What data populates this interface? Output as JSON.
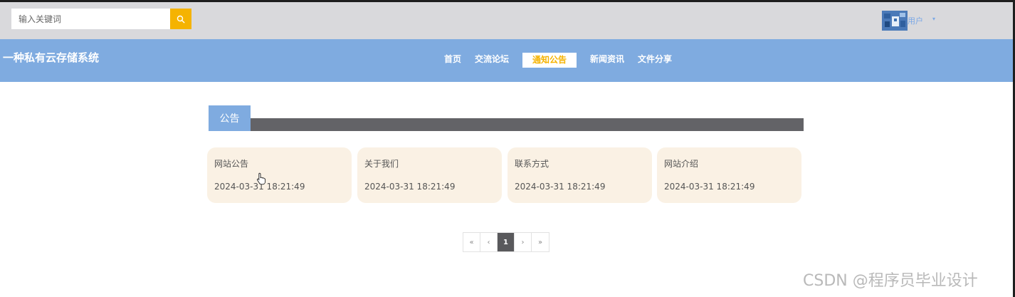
{
  "search": {
    "placeholder": "输入关键词",
    "icon": "search-icon"
  },
  "user": {
    "label": "用户",
    "caret": "▾"
  },
  "site": {
    "title": "一种私有云存储系统"
  },
  "nav": {
    "items": [
      {
        "label": "首页",
        "active": false
      },
      {
        "label": "交流论坛",
        "active": false
      },
      {
        "label": "通知公告",
        "active": true
      },
      {
        "label": "新闻资讯",
        "active": false
      },
      {
        "label": "文件分享",
        "active": false
      }
    ]
  },
  "section": {
    "title": "公告"
  },
  "notices": [
    {
      "title": "网站公告",
      "date": "2024-03-31 18:21:49"
    },
    {
      "title": "关于我们",
      "date": "2024-03-31 18:21:49"
    },
    {
      "title": "联系方式",
      "date": "2024-03-31 18:21:49"
    },
    {
      "title": "网站介绍",
      "date": "2024-03-31 18:21:49"
    }
  ],
  "pagination": {
    "first": "«",
    "prev": "‹",
    "current": "1",
    "next": "›",
    "last": "»"
  },
  "watermark": "CSDN @程序员毕业设计",
  "colors": {
    "accent": "#f5b301",
    "nav_bg": "#7fabe0",
    "topbar_bg": "#d9d9dc",
    "section_bar": "#636367",
    "card_bg": "#faf1e4"
  }
}
